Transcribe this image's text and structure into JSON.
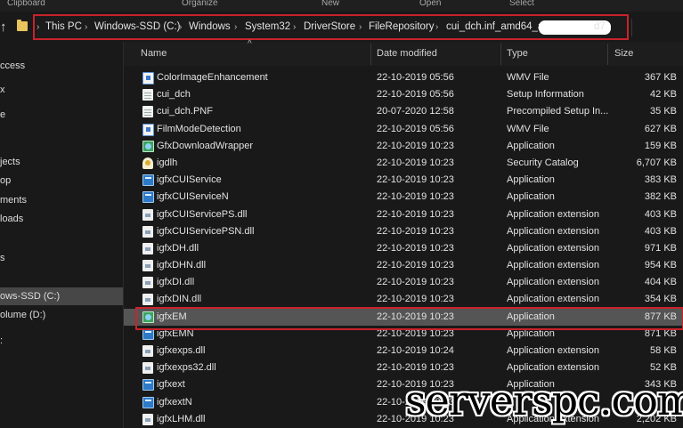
{
  "ribbon": {
    "labels": [
      "Clipboard",
      "Organize",
      "New",
      "Open",
      "Select"
    ]
  },
  "address": {
    "crumbs": [
      "This PC",
      "Windows-SSD (C:)",
      "Windows",
      "System32",
      "DriverStore",
      "FileRepository",
      "cui_dch.inf_amd64_af",
      "d7"
    ]
  },
  "nav": {
    "items": [
      "ccess",
      "x",
      "e",
      "jects",
      "op",
      "ments",
      "loads",
      "s",
      "ows-SSD (C:)",
      "olume (D:)",
      ":"
    ]
  },
  "columns": {
    "name": "Name",
    "date": "Date modified",
    "type": "Type",
    "size": "Size"
  },
  "files": [
    {
      "name": "ColorImageEnhancement",
      "date": "22-10-2019 05:56",
      "type": "WMV File",
      "size": "367 KB",
      "icon": "wmv-file-icon"
    },
    {
      "name": "cui_dch",
      "date": "22-10-2019 05:56",
      "type": "Setup Information",
      "size": "42 KB",
      "icon": "setup-info-icon"
    },
    {
      "name": "cui_dch.PNF",
      "date": "20-07-2020 12:58",
      "type": "Precompiled Setup In...",
      "size": "35 KB",
      "icon": "file-icon"
    },
    {
      "name": "FilmModeDetection",
      "date": "22-10-2019 05:56",
      "type": "WMV File",
      "size": "627 KB",
      "icon": "wmv-file-icon"
    },
    {
      "name": "GfxDownloadWrapper",
      "date": "22-10-2019 10:23",
      "type": "Application",
      "size": "159 KB",
      "icon": "green-app-icon"
    },
    {
      "name": "igdlh",
      "date": "22-10-2019 10:23",
      "type": "Security Catalog",
      "size": "6,707 KB",
      "icon": "catalog-icon"
    },
    {
      "name": "igfxCUIService",
      "date": "22-10-2019 10:23",
      "type": "Application",
      "size": "383 KB",
      "icon": "app-icon"
    },
    {
      "name": "igfxCUIServiceN",
      "date": "22-10-2019 10:23",
      "type": "Application",
      "size": "382 KB",
      "icon": "app-icon"
    },
    {
      "name": "igfxCUIServicePS.dll",
      "date": "22-10-2019 10:23",
      "type": "Application extension",
      "size": "403 KB",
      "icon": "dll-icon"
    },
    {
      "name": "igfxCUIServicePSN.dll",
      "date": "22-10-2019 10:23",
      "type": "Application extension",
      "size": "403 KB",
      "icon": "dll-icon"
    },
    {
      "name": "igfxDH.dll",
      "date": "22-10-2019 10:23",
      "type": "Application extension",
      "size": "971 KB",
      "icon": "dll-icon"
    },
    {
      "name": "igfxDHN.dll",
      "date": "22-10-2019 10:23",
      "type": "Application extension",
      "size": "954 KB",
      "icon": "dll-icon"
    },
    {
      "name": "igfxDI.dll",
      "date": "22-10-2019 10:23",
      "type": "Application extension",
      "size": "404 KB",
      "icon": "dll-icon"
    },
    {
      "name": "igfxDIN.dll",
      "date": "22-10-2019 10:23",
      "type": "Application extension",
      "size": "354 KB",
      "icon": "dll-icon"
    },
    {
      "name": "igfxEM",
      "date": "22-10-2019 10:23",
      "type": "Application",
      "size": "877 KB",
      "icon": "green-app-icon",
      "selected": true
    },
    {
      "name": "igfxEMN",
      "date": "22-10-2019 10:23",
      "type": "Application",
      "size": "871 KB",
      "icon": "app-icon"
    },
    {
      "name": "igfxexps.dll",
      "date": "22-10-2019 10:24",
      "type": "Application extension",
      "size": "58 KB",
      "icon": "dll-icon"
    },
    {
      "name": "igfxexps32.dll",
      "date": "22-10-2019 10:23",
      "type": "Application extension",
      "size": "52 KB",
      "icon": "dll-icon"
    },
    {
      "name": "igfxext",
      "date": "22-10-2019 10:23",
      "type": "Application",
      "size": "343 KB",
      "icon": "app-icon"
    },
    {
      "name": "igfxextN",
      "date": "22-10-2019 10:23",
      "type": "",
      "size": "",
      "icon": "app-icon"
    },
    {
      "name": "igfxLHM.dll",
      "date": "22-10-2019 10:23",
      "type": "Application extension",
      "size": "2,202 KB",
      "icon": "dll-icon"
    }
  ],
  "watermark": "serverspc.com",
  "colors": {
    "highlight": "#c9232b",
    "selection": "#555555",
    "background": "#191919"
  }
}
